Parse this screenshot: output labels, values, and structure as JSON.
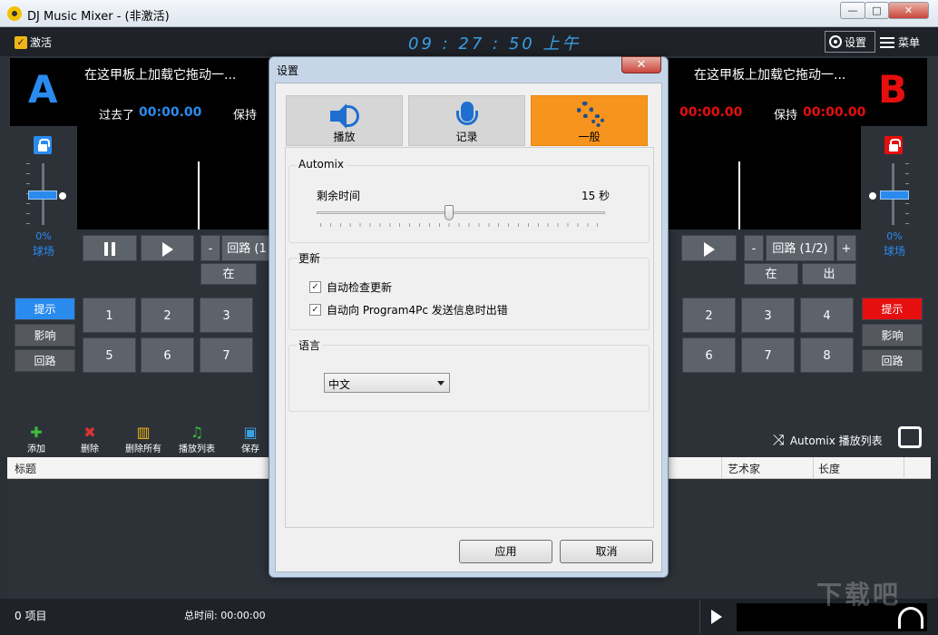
{
  "window": {
    "title": "DJ Music Mixer - (非激活)",
    "min": "—",
    "max": "□",
    "close": "✕"
  },
  "toolbar": {
    "activate": "激活",
    "clock": "09 : 27 : 50 上午",
    "settings": "设置",
    "menu": "菜单"
  },
  "deck_a": {
    "letter": "A",
    "message": "在这甲板上加载它拖动一...",
    "elapsed_label": "过去了",
    "elapsed": "00:00.00",
    "remain_label": "保持",
    "pitch": "0%",
    "field": "球场",
    "loop_minus": "-",
    "loop_label": "回路 (1",
    "in": "在",
    "cue": "提示",
    "effect": "影响",
    "loop": "回路",
    "pads": [
      "1",
      "2",
      "3",
      "5",
      "6",
      "7"
    ]
  },
  "deck_b": {
    "letter": "B",
    "message": "在这甲板上加载它拖动一...",
    "elapsed": "00:00.00",
    "remain_label": "保持",
    "remain": "00:00.00",
    "pitch": "0%",
    "field": "球场",
    "loop_minus": "-",
    "loop_label": "回路 (1/2)",
    "loop_plus": "+",
    "in": "在",
    "out": "出",
    "cue": "提示",
    "effect": "影响",
    "loop": "回路",
    "pads": [
      "2",
      "3",
      "4",
      "6",
      "7",
      "8"
    ]
  },
  "library": {
    "tools": [
      "添加",
      "删除",
      "删除所有",
      "播放列表",
      "保存"
    ],
    "automix": "Automix 播放列表",
    "columns": {
      "title": "标题",
      "artist": "艺术家",
      "length": "长度"
    }
  },
  "status": {
    "items": "0  项目",
    "total": "总时间: 00:00:00"
  },
  "dialog": {
    "title": "设置",
    "close": "✕",
    "tabs": [
      {
        "label": "播放"
      },
      {
        "label": "记录"
      },
      {
        "label": "一般"
      }
    ],
    "automix_group": "Automix",
    "remaining_label": "剩余时间",
    "remaining_value": "15 秒",
    "slider_level": 0.46,
    "update_group": "更新",
    "auto_check": "自动检查更新",
    "auto_send": "自动向 Program4Pc 发送信息时出错",
    "lang_group": "语言",
    "lang_value": "中文",
    "apply": "应用",
    "cancel": "取消"
  },
  "watermark": "下载吧"
}
